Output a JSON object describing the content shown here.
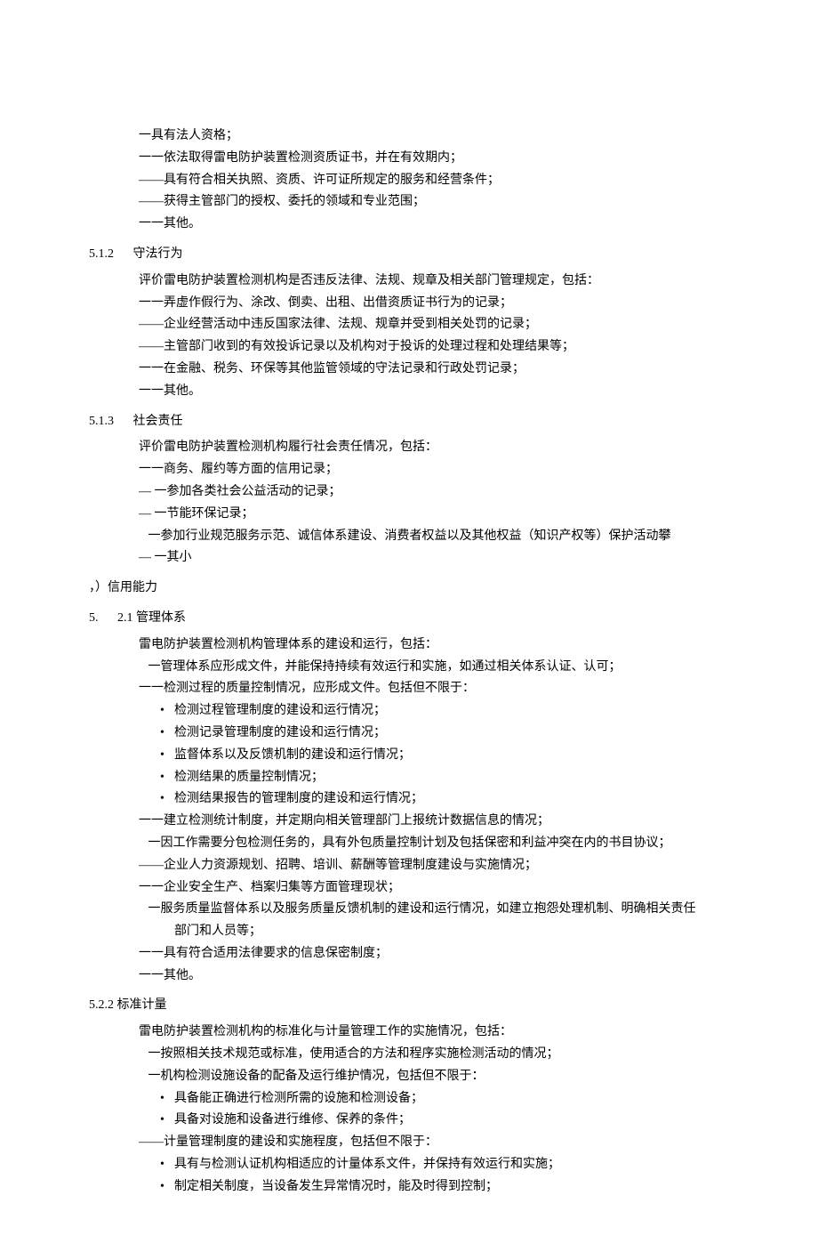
{
  "s511_intro": [
    "一具有法人资格；",
    "一一依法取得雷电防护装置检测资质证书，并在有效期内；",
    "——具有符合相关执照、资质、许可证所规定的服务和经营条件；",
    "——获得主管部门的授权、委托的领域和专业范围；",
    "一一其他。"
  ],
  "s512": {
    "num": "5.1.2",
    "title": "守法行为",
    "lead": "评价雷电防护装置检测机构是否违反法律、法规、规章及相关部门管理规定，包括：",
    "items": [
      "一一弄虚作假行为、涂改、倒卖、出租、出借资质证书行为的记录；",
      "——企业经营活动中违反国家法律、法规、规章并受到相关处罚的记录；",
      "——主管部门收到的有效投诉记录以及机构对于投诉的处理过程和处理结果等；",
      "一一在金融、税务、环保等其他监管领域的守法记录和行政处罚记录；",
      "一一其他。"
    ]
  },
  "s513": {
    "num": "5.1.3",
    "title": "社会责任",
    "lead": "评价雷电防护装置检测机构履行社会责任情况，包括：",
    "items": [
      "一一商务、履约等方面的信用记录；",
      "—  一参加各类社会公益活动的记录；",
      "—  一节能环保记录；",
      "   一参加行业规范服务示范、诚信体系建设、消费者权益以及其他权益（知识产权等）保护活动攀",
      "—  一其小"
    ]
  },
  "s52_header": "，）信用能力",
  "s521": {
    "num": "5.",
    "title": "2.1 管理体系",
    "lead": "雷电防护装置检测机构管理体系的建设和运行，包括：",
    "items1": [
      "   一管理体系应形成文件，并能保持持续有效运行和实施，如通过相关体系认证、认可；",
      "一一检测过程的质量控制情况，应形成文件。包括但不限于："
    ],
    "bullets1": [
      "检测过程管理制度的建设和运行情况；",
      "检测记录管理制度的建设和运行情况；",
      "监督体系以及反馈机制的建设和运行情况；",
      "检测结果的质量控制情况；",
      "检测结果报告的管理制度的建设和运行情况；"
    ],
    "items2": [
      "一一建立检测统计制度，并定期向相关管理部门上报统计数据信息的情况；",
      "   一因工作需要分包检测任务的，具有外包质量控制计划及包括保密和利益冲突在内的书目协议；",
      "——企业人力资源规划、招聘、培训、薪酬等管理制度建设与实施情况；",
      "一一企业安全生产、档案归集等方面管理现状；",
      "   一服务质量监督体系以及服务质量反馈机制的建设和运行情况，如建立抱怨处理机制、明确相关责任"
    ],
    "cont": "部门和人员等；",
    "items3": [
      "一一具有符合适用法律要求的信息保密制度；",
      "一一其他。"
    ]
  },
  "s522": {
    "num": "5.2.2",
    "title": "标准计量",
    "lead": "雷电防护装置检测机构的标准化与计量管理工作的实施情况，包括：",
    "items1": [
      "   一按照相关技术规范或标准，使用适合的方法和程序实施检测活动的情况；",
      "   一机构检测设施设备的配备及运行维护情况，包括但不限于："
    ],
    "bullets1": [
      "具备能正确进行检测所需的设施和检测设备；",
      "具备对设施和设备进行维修、保养的条件；"
    ],
    "items2": [
      "——计量管理制度的建设和实施程度，包括但不限于："
    ],
    "bullets2": [
      "具有与检测认证机构相适应的计量体系文件，并保持有效运行和实施；",
      "制定相关制度，当设备发生异常情况时，能及时得到控制；"
    ]
  }
}
